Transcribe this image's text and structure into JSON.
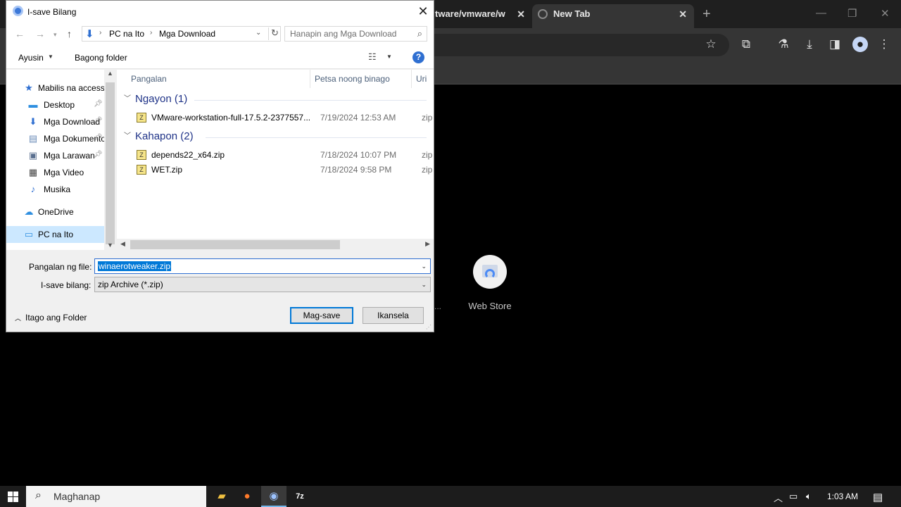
{
  "browser": {
    "tabs": [
      {
        "label": "tware/vmware/w"
      },
      {
        "label": "New Tab"
      }
    ],
    "new_tab_tile": {
      "label": "Web Store"
    },
    "tile_partial_dots": "..."
  },
  "dialog": {
    "title": "I-save Bilang",
    "address": {
      "segments": [
        "PC na Ito",
        "Mga Download"
      ]
    },
    "search": {
      "placeholder": "Hanapin ang Mga Download"
    },
    "commands": {
      "organize": "Ayusin",
      "new_folder": "Bagong folder"
    },
    "nav_pane": {
      "items": [
        {
          "label": "Mabilis na access",
          "icon": "star-icon"
        },
        {
          "label": "Desktop",
          "icon": "desktop-icon",
          "pinned": true
        },
        {
          "label": "Mga Download",
          "icon": "download-icon",
          "pinned": true
        },
        {
          "label": "Mga Dokumento",
          "icon": "document-icon",
          "pinned": true
        },
        {
          "label": "Mga Larawan",
          "icon": "pictures-icon",
          "pinned": true
        },
        {
          "label": "Mga Video",
          "icon": "video-icon"
        },
        {
          "label": "Musika",
          "icon": "music-icon"
        },
        {
          "label": "OneDrive",
          "icon": "cloud-icon"
        },
        {
          "label": "PC na Ito",
          "icon": "computer-icon",
          "selected": true
        }
      ]
    },
    "columns": {
      "name": "Pangalan",
      "date_modified": "Petsa noong binago",
      "type": "Uri"
    },
    "groups": [
      {
        "label": "Ngayon (1)",
        "files": [
          {
            "name": "VMware-workstation-full-17.5.2-2377557...",
            "date": "7/19/2024 12:53 AM",
            "type": "zip A"
          }
        ]
      },
      {
        "label": "Kahapon (2)",
        "files": [
          {
            "name": "depends22_x64.zip",
            "date": "7/18/2024 10:07 PM",
            "type": "zip A"
          },
          {
            "name": "WET.zip",
            "date": "7/18/2024 9:58 PM",
            "type": "zip A"
          }
        ]
      }
    ],
    "file_name": {
      "label": "Pangalan ng file:",
      "value": "winaerotweaker.zip"
    },
    "save_as_type": {
      "label": "I-save bilang:",
      "value": "zip Archive (*.zip)"
    },
    "hide_folders": "Itago ang Folder",
    "save_button": "Mag-save",
    "cancel_button": "Ikansela"
  },
  "taskbar": {
    "search_placeholder": "Maghanap",
    "clock": "1:03 AM"
  },
  "colors": {
    "accent": "#0078d7",
    "selection": "#cce8ff",
    "group_header": "#1e3287"
  }
}
